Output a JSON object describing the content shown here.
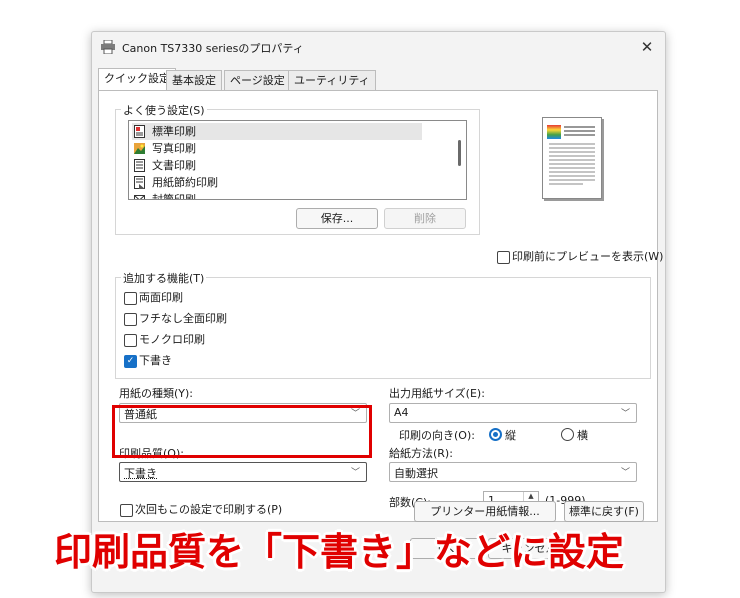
{
  "window": {
    "title": "Canon TS7330 seriesのプロパティ",
    "close_glyph": "✕"
  },
  "tabs": [
    {
      "label": "クイック設定",
      "active": true
    },
    {
      "label": "基本設定",
      "active": false
    },
    {
      "label": "ページ設定",
      "active": false
    },
    {
      "label": "ユーティリティ",
      "active": false
    }
  ],
  "favorites": {
    "legend": "よく使う設定(S)",
    "items": [
      {
        "label": "標準印刷",
        "icon": "standard-print-icon",
        "selected": true
      },
      {
        "label": "写真印刷",
        "icon": "photo-print-icon",
        "selected": false
      },
      {
        "label": "文書印刷",
        "icon": "document-print-icon",
        "selected": false
      },
      {
        "label": "用紙節約印刷",
        "icon": "paper-saving-icon",
        "selected": false
      },
      {
        "label": "封筒印刷",
        "icon": "envelope-icon",
        "selected": false
      }
    ],
    "save_label": "保存...",
    "delete_label": "削除"
  },
  "preview": {
    "checkbox_label": "印刷前にプレビューを表示(W)",
    "checked": false
  },
  "features": {
    "legend": "追加する機能(T)",
    "items": [
      {
        "label": "両面印刷",
        "checked": false
      },
      {
        "label": "フチなし全面印刷",
        "checked": false
      },
      {
        "label": "モノクロ印刷",
        "checked": false
      },
      {
        "label": "下書き",
        "checked": true
      }
    ]
  },
  "media_type": {
    "label": "用紙の種類(Y):",
    "value": "普通紙"
  },
  "output_size": {
    "label": "出力用紙サイズ(E):",
    "value": "A4"
  },
  "orientation": {
    "label": "印刷の向き(O):",
    "options": [
      {
        "label": "縦",
        "selected": true
      },
      {
        "label": "横",
        "selected": false
      }
    ]
  },
  "print_quality": {
    "label": "印刷品質(Q):",
    "value": "下書き"
  },
  "paper_source": {
    "label": "給紙方法(R):",
    "value": "自動選択"
  },
  "copies": {
    "label": "部数(C):",
    "value": "1",
    "range": "(1-999)"
  },
  "footer": {
    "always_print_label": "次回もこの設定で印刷する(P)",
    "printer_media_label": "プリンター用紙情報...",
    "defaults_label": "標準に戻す(F)",
    "ok_label": "OK",
    "cancel_label": "キャンセル"
  },
  "caption": "印刷品質を「下書き」などに設定",
  "colors": {
    "highlight": "#e00000",
    "accent": "#1670c7"
  }
}
